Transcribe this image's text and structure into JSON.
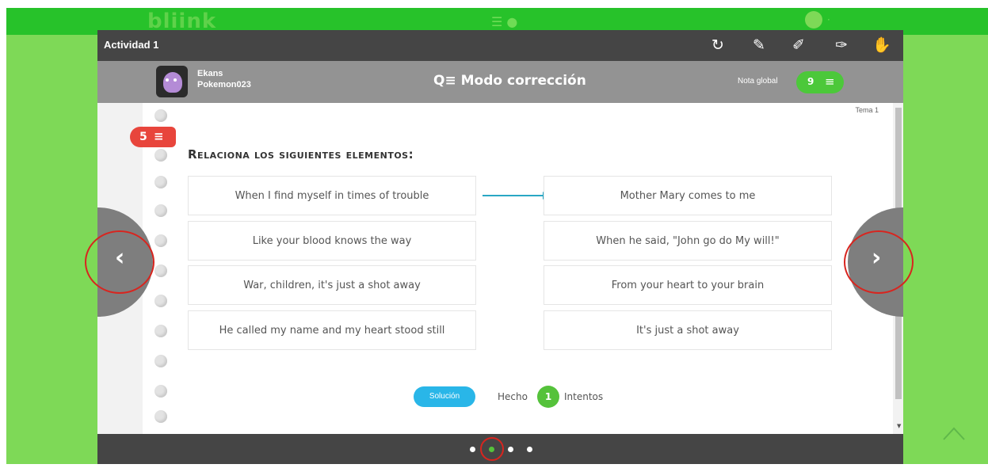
{
  "brand": {
    "logo": "bliink",
    "menu_icon": "menu-icon"
  },
  "window": {
    "title": "Actividad 1",
    "tools": [
      "refresh-icon",
      "pencil-icon",
      "marker-icon",
      "eraser-icon",
      "hand-icon"
    ]
  },
  "student": {
    "name": "Ekans",
    "username": "Pokemon023"
  },
  "mode": {
    "icon": "search-list-icon",
    "label": "Modo corrección"
  },
  "grade": {
    "label": "Nota global",
    "value": "9"
  },
  "sheet": {
    "tema": "Tema 1",
    "badge_value": "5",
    "heading": "Relaciona los siguientes elementos:",
    "left_items": [
      "When I find myself in times of trouble",
      "Like your blood knows the way",
      "War, children, it's just a shot away",
      "He called my name and my heart stood still"
    ],
    "right_items": [
      "Mother Mary comes to me",
      "When he said, \"John go do My will!\"",
      "From your heart to your brain",
      "It's just a shot away"
    ],
    "connection": {
      "from": "When I find myself in times of trouble",
      "to": "Mother Mary comes to me"
    }
  },
  "footer": {
    "solution_label": "Solución",
    "done_label": "Hecho",
    "attempts_count": "1",
    "attempts_label": "Intentos"
  },
  "pagination": {
    "pages": 4,
    "active_index": 1
  },
  "colors": {
    "brand_green": "#27c22a",
    "accent_red": "#e8453c",
    "badge_green": "#4cc83a",
    "solution_blue": "#29b6e8",
    "connector_teal": "#2aa7c4"
  }
}
